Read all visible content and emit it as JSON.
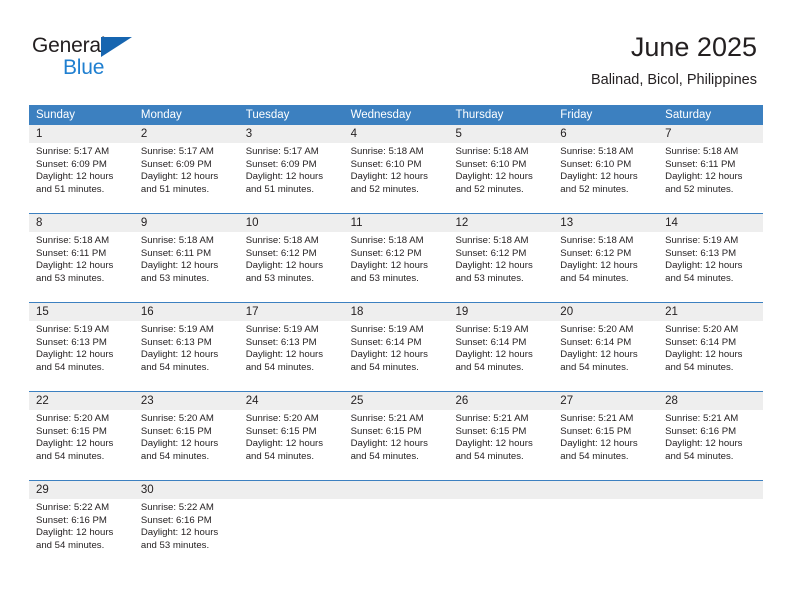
{
  "brand": {
    "name_top": "General",
    "name_bottom": "Blue",
    "triangle_icon": "brand-triangle-icon",
    "accent_color": "#1f7fd0"
  },
  "header": {
    "title": "June 2025",
    "subtitle": "Balinad, Bicol, Philippines"
  },
  "colors": {
    "header_blue": "#3c80c0",
    "daynum_band": "#eeeeee",
    "text": "#231f20"
  },
  "weekdays": [
    "Sunday",
    "Monday",
    "Tuesday",
    "Wednesday",
    "Thursday",
    "Friday",
    "Saturday"
  ],
  "weeks": [
    {
      "days": [
        {
          "date": "1",
          "sunrise": "Sunrise: 5:17 AM",
          "sunset": "Sunset: 6:09 PM",
          "daylight_1": "Daylight: 12 hours",
          "daylight_2": "and 51 minutes."
        },
        {
          "date": "2",
          "sunrise": "Sunrise: 5:17 AM",
          "sunset": "Sunset: 6:09 PM",
          "daylight_1": "Daylight: 12 hours",
          "daylight_2": "and 51 minutes."
        },
        {
          "date": "3",
          "sunrise": "Sunrise: 5:17 AM",
          "sunset": "Sunset: 6:09 PM",
          "daylight_1": "Daylight: 12 hours",
          "daylight_2": "and 51 minutes."
        },
        {
          "date": "4",
          "sunrise": "Sunrise: 5:18 AM",
          "sunset": "Sunset: 6:10 PM",
          "daylight_1": "Daylight: 12 hours",
          "daylight_2": "and 52 minutes."
        },
        {
          "date": "5",
          "sunrise": "Sunrise: 5:18 AM",
          "sunset": "Sunset: 6:10 PM",
          "daylight_1": "Daylight: 12 hours",
          "daylight_2": "and 52 minutes."
        },
        {
          "date": "6",
          "sunrise": "Sunrise: 5:18 AM",
          "sunset": "Sunset: 6:10 PM",
          "daylight_1": "Daylight: 12 hours",
          "daylight_2": "and 52 minutes."
        },
        {
          "date": "7",
          "sunrise": "Sunrise: 5:18 AM",
          "sunset": "Sunset: 6:11 PM",
          "daylight_1": "Daylight: 12 hours",
          "daylight_2": "and 52 minutes."
        }
      ]
    },
    {
      "days": [
        {
          "date": "8",
          "sunrise": "Sunrise: 5:18 AM",
          "sunset": "Sunset: 6:11 PM",
          "daylight_1": "Daylight: 12 hours",
          "daylight_2": "and 53 minutes."
        },
        {
          "date": "9",
          "sunrise": "Sunrise: 5:18 AM",
          "sunset": "Sunset: 6:11 PM",
          "daylight_1": "Daylight: 12 hours",
          "daylight_2": "and 53 minutes."
        },
        {
          "date": "10",
          "sunrise": "Sunrise: 5:18 AM",
          "sunset": "Sunset: 6:12 PM",
          "daylight_1": "Daylight: 12 hours",
          "daylight_2": "and 53 minutes."
        },
        {
          "date": "11",
          "sunrise": "Sunrise: 5:18 AM",
          "sunset": "Sunset: 6:12 PM",
          "daylight_1": "Daylight: 12 hours",
          "daylight_2": "and 53 minutes."
        },
        {
          "date": "12",
          "sunrise": "Sunrise: 5:18 AM",
          "sunset": "Sunset: 6:12 PM",
          "daylight_1": "Daylight: 12 hours",
          "daylight_2": "and 53 minutes."
        },
        {
          "date": "13",
          "sunrise": "Sunrise: 5:18 AM",
          "sunset": "Sunset: 6:12 PM",
          "daylight_1": "Daylight: 12 hours",
          "daylight_2": "and 54 minutes."
        },
        {
          "date": "14",
          "sunrise": "Sunrise: 5:19 AM",
          "sunset": "Sunset: 6:13 PM",
          "daylight_1": "Daylight: 12 hours",
          "daylight_2": "and 54 minutes."
        }
      ]
    },
    {
      "days": [
        {
          "date": "15",
          "sunrise": "Sunrise: 5:19 AM",
          "sunset": "Sunset: 6:13 PM",
          "daylight_1": "Daylight: 12 hours",
          "daylight_2": "and 54 minutes."
        },
        {
          "date": "16",
          "sunrise": "Sunrise: 5:19 AM",
          "sunset": "Sunset: 6:13 PM",
          "daylight_1": "Daylight: 12 hours",
          "daylight_2": "and 54 minutes."
        },
        {
          "date": "17",
          "sunrise": "Sunrise: 5:19 AM",
          "sunset": "Sunset: 6:13 PM",
          "daylight_1": "Daylight: 12 hours",
          "daylight_2": "and 54 minutes."
        },
        {
          "date": "18",
          "sunrise": "Sunrise: 5:19 AM",
          "sunset": "Sunset: 6:14 PM",
          "daylight_1": "Daylight: 12 hours",
          "daylight_2": "and 54 minutes."
        },
        {
          "date": "19",
          "sunrise": "Sunrise: 5:19 AM",
          "sunset": "Sunset: 6:14 PM",
          "daylight_1": "Daylight: 12 hours",
          "daylight_2": "and 54 minutes."
        },
        {
          "date": "20",
          "sunrise": "Sunrise: 5:20 AM",
          "sunset": "Sunset: 6:14 PM",
          "daylight_1": "Daylight: 12 hours",
          "daylight_2": "and 54 minutes."
        },
        {
          "date": "21",
          "sunrise": "Sunrise: 5:20 AM",
          "sunset": "Sunset: 6:14 PM",
          "daylight_1": "Daylight: 12 hours",
          "daylight_2": "and 54 minutes."
        }
      ]
    },
    {
      "days": [
        {
          "date": "22",
          "sunrise": "Sunrise: 5:20 AM",
          "sunset": "Sunset: 6:15 PM",
          "daylight_1": "Daylight: 12 hours",
          "daylight_2": "and 54 minutes."
        },
        {
          "date": "23",
          "sunrise": "Sunrise: 5:20 AM",
          "sunset": "Sunset: 6:15 PM",
          "daylight_1": "Daylight: 12 hours",
          "daylight_2": "and 54 minutes."
        },
        {
          "date": "24",
          "sunrise": "Sunrise: 5:20 AM",
          "sunset": "Sunset: 6:15 PM",
          "daylight_1": "Daylight: 12 hours",
          "daylight_2": "and 54 minutes."
        },
        {
          "date": "25",
          "sunrise": "Sunrise: 5:21 AM",
          "sunset": "Sunset: 6:15 PM",
          "daylight_1": "Daylight: 12 hours",
          "daylight_2": "and 54 minutes."
        },
        {
          "date": "26",
          "sunrise": "Sunrise: 5:21 AM",
          "sunset": "Sunset: 6:15 PM",
          "daylight_1": "Daylight: 12 hours",
          "daylight_2": "and 54 minutes."
        },
        {
          "date": "27",
          "sunrise": "Sunrise: 5:21 AM",
          "sunset": "Sunset: 6:15 PM",
          "daylight_1": "Daylight: 12 hours",
          "daylight_2": "and 54 minutes."
        },
        {
          "date": "28",
          "sunrise": "Sunrise: 5:21 AM",
          "sunset": "Sunset: 6:16 PM",
          "daylight_1": "Daylight: 12 hours",
          "daylight_2": "and 54 minutes."
        }
      ]
    },
    {
      "days": [
        {
          "date": "29",
          "sunrise": "Sunrise: 5:22 AM",
          "sunset": "Sunset: 6:16 PM",
          "daylight_1": "Daylight: 12 hours",
          "daylight_2": "and 54 minutes."
        },
        {
          "date": "30",
          "sunrise": "Sunrise: 5:22 AM",
          "sunset": "Sunset: 6:16 PM",
          "daylight_1": "Daylight: 12 hours",
          "daylight_2": "and 53 minutes."
        },
        {
          "date": "",
          "sunrise": "",
          "sunset": "",
          "daylight_1": "",
          "daylight_2": ""
        },
        {
          "date": "",
          "sunrise": "",
          "sunset": "",
          "daylight_1": "",
          "daylight_2": ""
        },
        {
          "date": "",
          "sunrise": "",
          "sunset": "",
          "daylight_1": "",
          "daylight_2": ""
        },
        {
          "date": "",
          "sunrise": "",
          "sunset": "",
          "daylight_1": "",
          "daylight_2": ""
        },
        {
          "date": "",
          "sunrise": "",
          "sunset": "",
          "daylight_1": "",
          "daylight_2": ""
        }
      ]
    }
  ]
}
